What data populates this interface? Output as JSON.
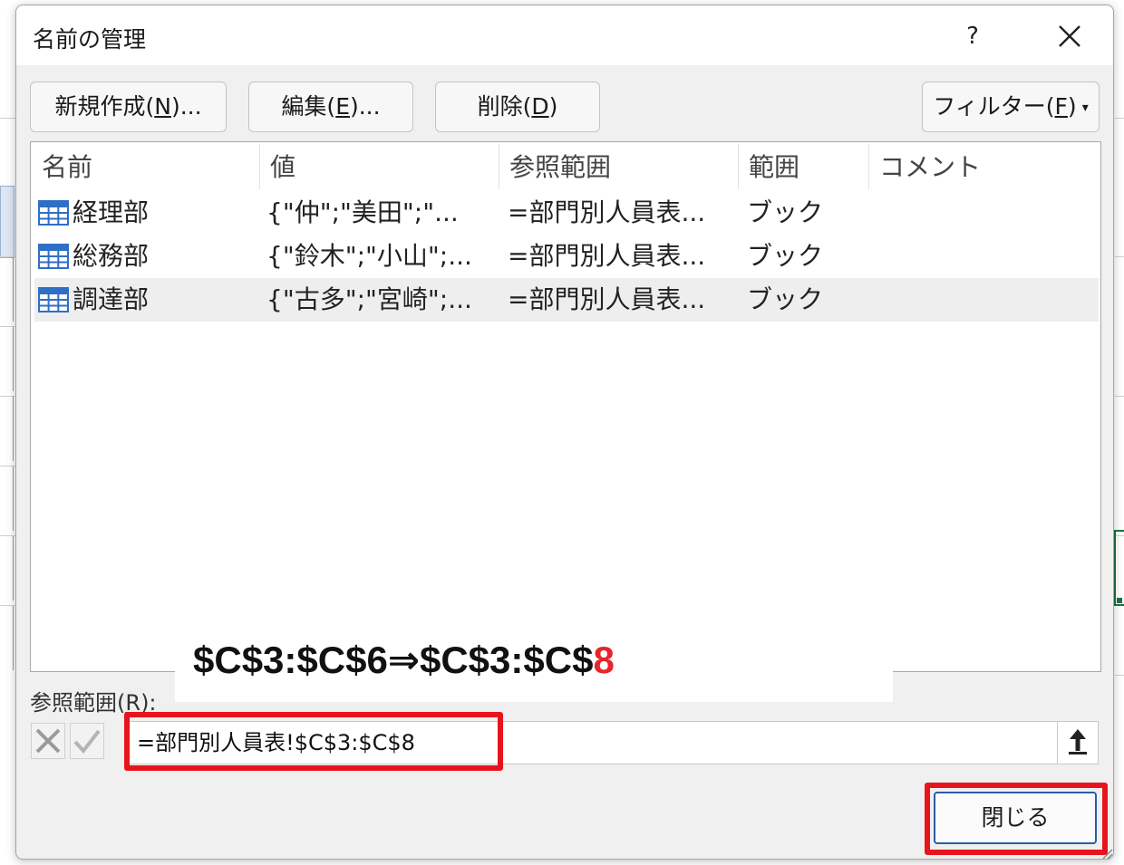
{
  "dialog": {
    "title": "名前の管理",
    "help_label": "?",
    "close_icon": "close-icon"
  },
  "toolbar": {
    "new_label": "新規作成(",
    "new_key": "N",
    "new_suffix": ")...",
    "edit_label": "編集(",
    "edit_key": "E",
    "edit_suffix": ")...",
    "delete_label": "削除(",
    "delete_key": "D",
    "delete_suffix": ")",
    "filter_label": "フィルター(",
    "filter_key": "F",
    "filter_suffix": ")",
    "filter_arrow": "▾"
  },
  "list": {
    "columns": [
      "名前",
      "値",
      "参照範囲",
      "範囲",
      "コメント"
    ],
    "rows": [
      {
        "name": "経理部",
        "value": "{\"仲\";\"美田\";\"...",
        "refers_to": "=部門別人員表...",
        "scope": "ブック",
        "comment": ""
      },
      {
        "name": "総務部",
        "value": "{\"鈴木\";\"小山\";...",
        "refers_to": "=部門別人員表...",
        "scope": "ブック",
        "comment": ""
      },
      {
        "name": "調達部",
        "value": "{\"古多\";\"宮崎\";...",
        "refers_to": "=部門別人員表...",
        "scope": "ブック",
        "comment": ""
      }
    ],
    "selected_row": 2
  },
  "refers_to": {
    "label": "参照範囲(",
    "label_key": "R",
    "label_suffix": "):",
    "value": "=部門別人員表!$C$3:$C$8"
  },
  "annotation": {
    "text_main": "$C$3:$C$6⇒$C$3:$C$",
    "text_red": "8"
  },
  "footer": {
    "close_label": "閉じる"
  },
  "colors": {
    "highlight": "#e8141c",
    "annotation_red": "#e8242b",
    "table_icon_blue": "#2f6fc4"
  }
}
